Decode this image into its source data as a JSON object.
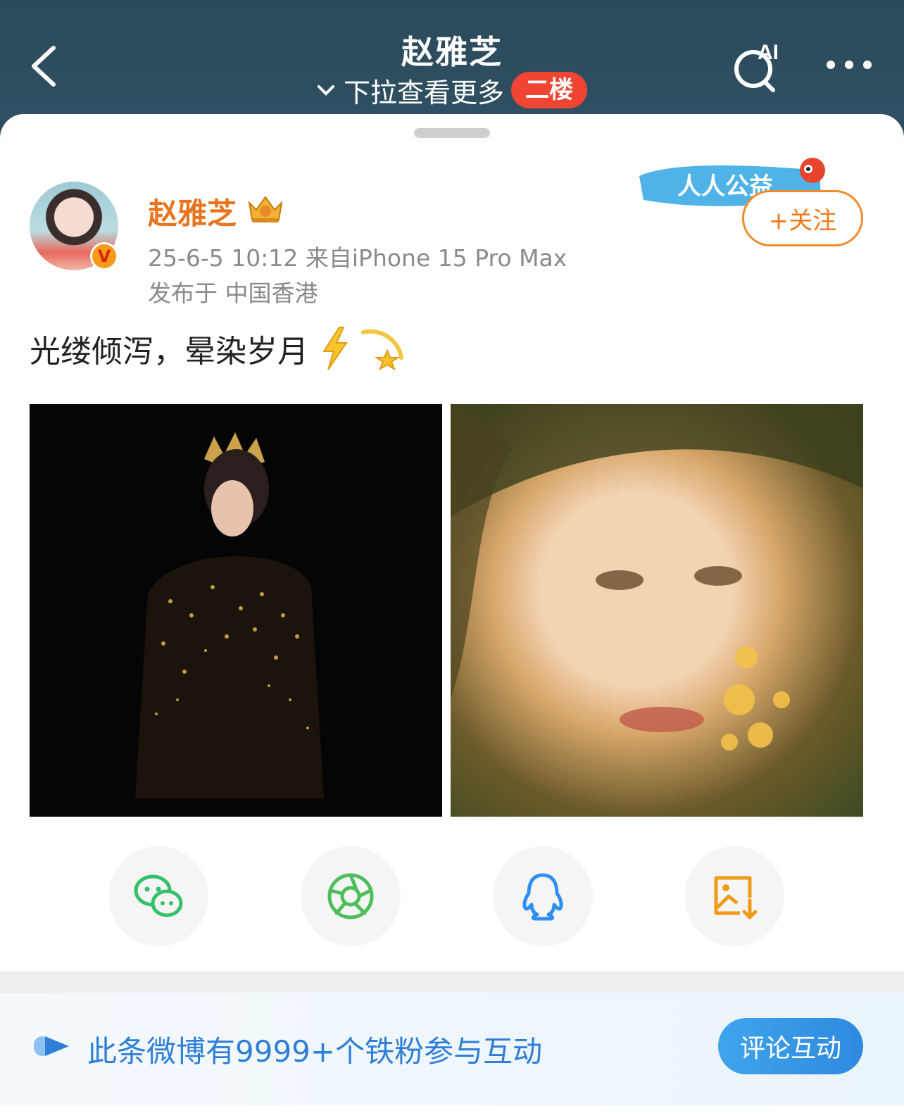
{
  "header": {
    "title": "赵雅芝",
    "subtitle": "下拉查看更多",
    "floor_badge": "二楼",
    "ai_label": "AI"
  },
  "post": {
    "username": "赵雅芝",
    "meta": "25-6-5 10:12  来自iPhone 15 Pro Max",
    "location": "发布于 中国香港",
    "text": "光缕倾泻，晕染岁月",
    "verified_badge": "V",
    "banner_text": "人人公益",
    "follow_label": "+关注"
  },
  "share": {
    "items": [
      "wechat-icon",
      "moments-icon",
      "qq-icon",
      "save-image-icon"
    ]
  },
  "fans": {
    "text": "此条微博有9999+个铁粉参与互动",
    "button": "评论互动"
  },
  "colors": {
    "header_bg": "#2d4c5e",
    "username": "#e8741f",
    "follow": "#f07a1a",
    "floor_badge": "#f04532",
    "link_blue": "#2f7fd8"
  }
}
